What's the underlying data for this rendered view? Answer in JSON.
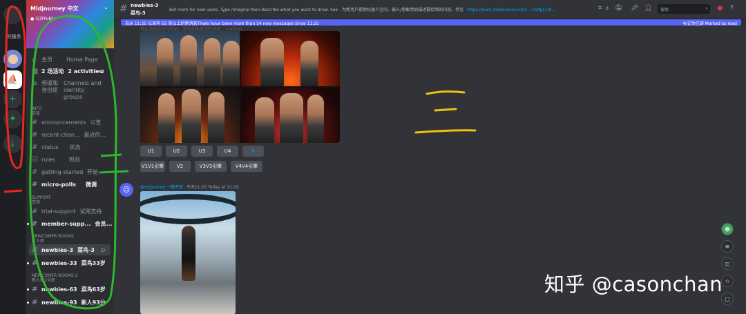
{
  "rail": {
    "label": "的服务",
    "items": [
      {
        "name": "home",
        "glyph": ""
      },
      {
        "name": "midjourney",
        "glyph": "⛵"
      },
      {
        "name": "add",
        "glyph": "+"
      },
      {
        "name": "explore",
        "glyph": "✦"
      },
      {
        "name": "download",
        "glyph": "⤓"
      }
    ]
  },
  "server": {
    "name": "Midjourney 中文",
    "subtitle": "● 公开Public",
    "chevron": "⌄"
  },
  "sidebar": {
    "nav": [
      {
        "zh": "主页",
        "en": "Home Page"
      },
      {
        "zh": "2 场活动",
        "en": "2 activities",
        "badge": "2"
      },
      {
        "zh": "频道和身份组",
        "en": "Channels and identity groups"
      }
    ],
    "categories": {
      "info": {
        "en": "INFO",
        "zh": "信息"
      },
      "support": {
        "en": "SUPPORT",
        "zh": "支持"
      },
      "newcomer": {
        "en": "NEWCOMER ROOMS",
        "zh": "新人房"
      },
      "newcomer2": {
        "en": "NEWCOMER ROOMS 2",
        "zh": "新人房2号房"
      }
    },
    "info_channels": [
      {
        "en": "announcements",
        "zh": "公告"
      },
      {
        "en": "recent-chan...",
        "zh": "最近的..."
      },
      {
        "en": "status",
        "zh": "状态"
      },
      {
        "en": "rules",
        "zh": "规则"
      },
      {
        "en": "getting-started",
        "zh": "开始"
      },
      {
        "en": "micro-polls",
        "zh": "微调"
      }
    ],
    "support_channels": [
      {
        "en": "trial-support",
        "zh": "试用支持"
      },
      {
        "en": "member-supp...",
        "zh": "会员..."
      }
    ],
    "newcomer_channels": [
      {
        "en": "newbies-3",
        "zh": "菜鸟-3"
      },
      {
        "en": "newbies-33",
        "zh": "菜鸟33岁"
      }
    ],
    "newcomer2_channels": [
      {
        "en": "newbies-63",
        "zh": "菜鸟63岁"
      },
      {
        "en": "newbies-93",
        "zh": "新人93分"
      }
    ]
  },
  "header": {
    "channel_en": "newbies-3",
    "channel_zh": "菜鸟-3",
    "topic": "Bot room for new users. Type /imagine then describe what you want to draw. See",
    "topic_zh": "为新用户提供机器人空间。输入/想象然后描述要绘制的内容。参见",
    "topic_link": "https://docs.midjourney.com/",
    "topic_link2": "<https://d...",
    "member_count": "0",
    "search_placeholder": "搜索"
  },
  "newbar": {
    "text": "自从 11:25 以来有 55 条以上的新消息There have been more than 54 new messages since 11:25",
    "mark": "标记为已读    Marked as read"
  },
  "messages": {
    "faded_line": "将此消息标记为阅读。 您在此处发送的消息... (edited)",
    "upscale_buttons": [
      "U1",
      "U2",
      "U3",
      "U4"
    ],
    "refresh_glyph": "↻",
    "variation_buttons": [
      "V1V1引擎",
      "V2",
      "V3V3引擎",
      "V4V4引擎"
    ],
    "author": "@mjjourney 一路平安",
    "time": "今天11:25  Today at 11:25"
  },
  "annotations": {
    "handwritten_marks": "三"
  },
  "watermark": "知乎 @casonchan"
}
